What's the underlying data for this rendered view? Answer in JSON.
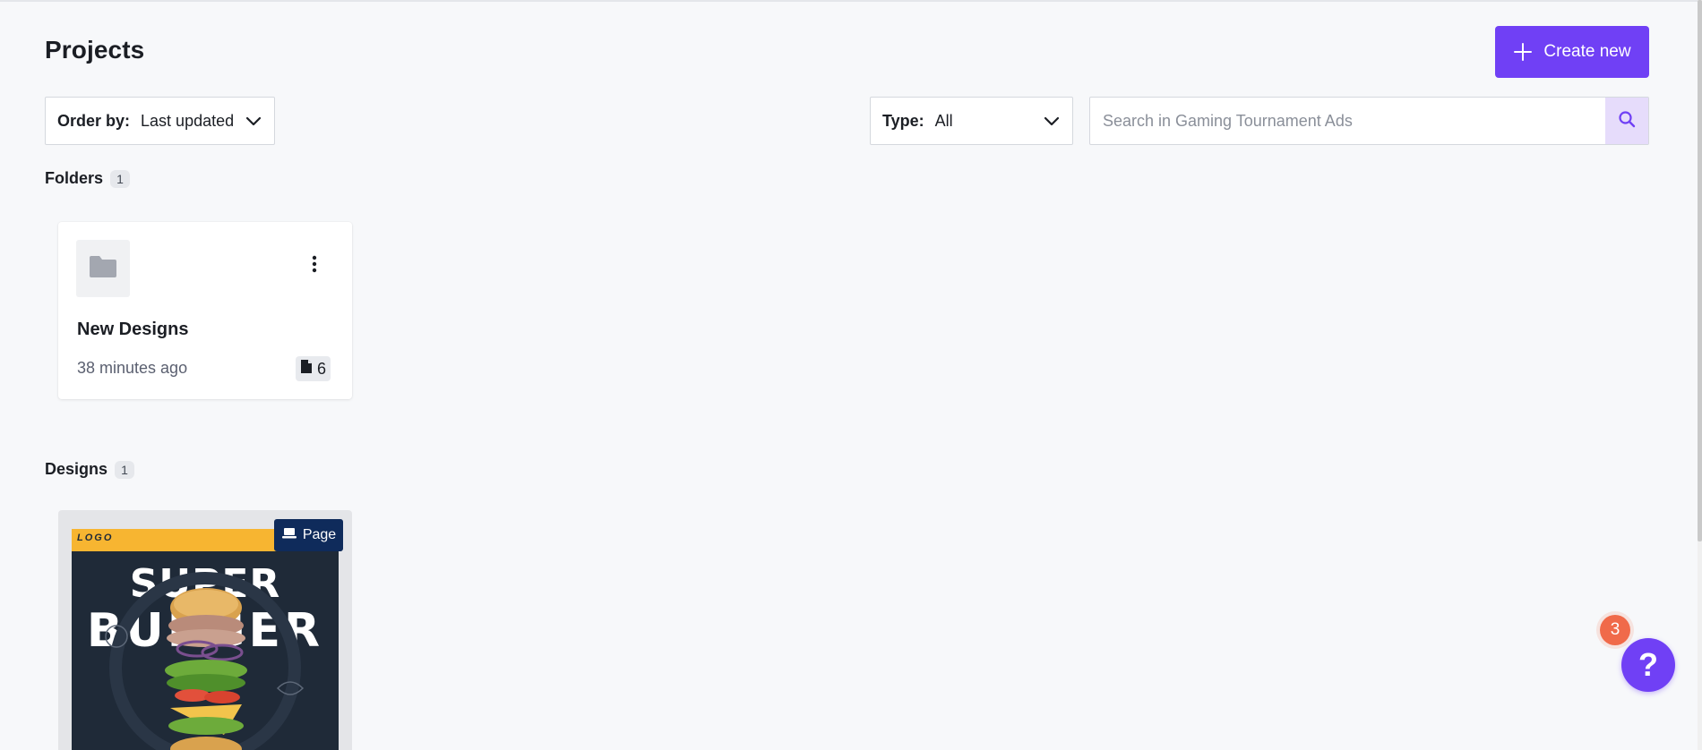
{
  "header": {
    "title": "Projects",
    "create_label": "Create new"
  },
  "filters": {
    "order_label": "Order by:",
    "order_value": "Last updated",
    "type_label": "Type:",
    "type_value": "All",
    "search_placeholder": "Search in Gaming Tournament Ads"
  },
  "folders": {
    "label": "Folders",
    "count": "1",
    "items": [
      {
        "name": "New Designs",
        "updated": "38 minutes ago",
        "file_count": "6"
      }
    ]
  },
  "designs": {
    "label": "Designs",
    "count": "1",
    "items": [
      {
        "type_badge": "Page",
        "poster_logo": "LOGO",
        "poster_words": [
          "SUPER",
          "BURGER"
        ]
      }
    ]
  },
  "help": {
    "glyph": "?",
    "notification_count": "3"
  },
  "colors": {
    "accent": "#7040f5",
    "badge_navy": "#0f2b5b",
    "notification": "#f06a4a",
    "poster_bar": "#f7b531",
    "poster_bg": "#1f2a38"
  },
  "icons": [
    "plus-icon",
    "chevron-down-icon",
    "search-icon",
    "folder-icon",
    "more-vertical-icon",
    "file-icon",
    "laptop-icon",
    "help-icon"
  ]
}
